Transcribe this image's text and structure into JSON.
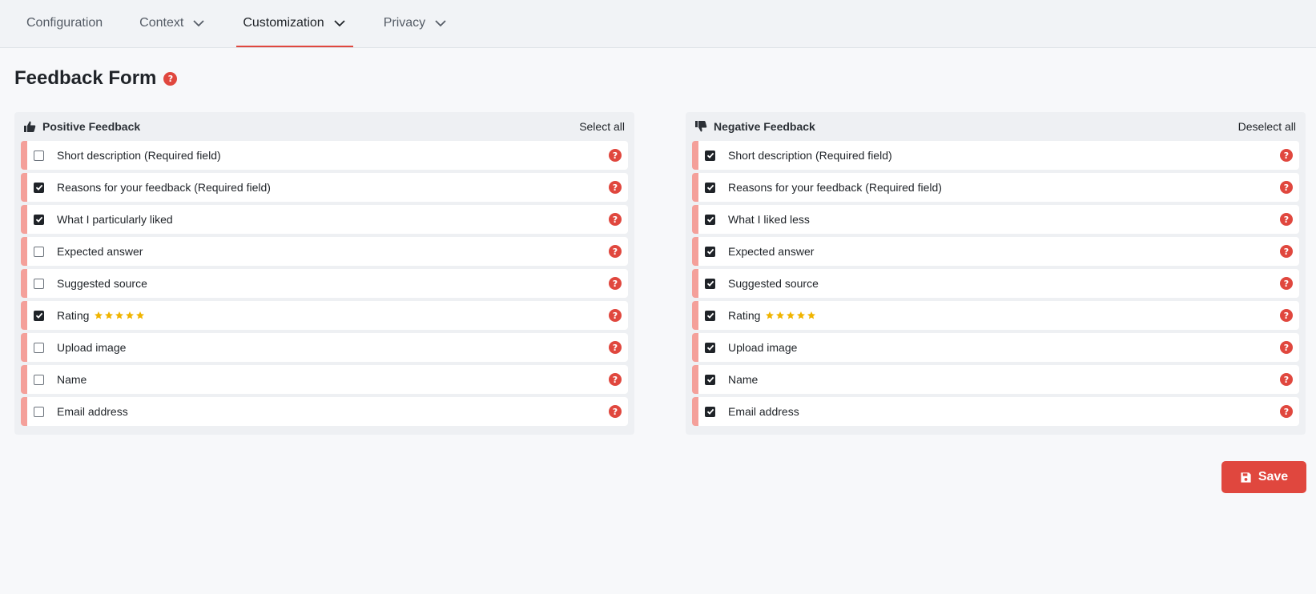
{
  "tabs": [
    {
      "label": "Configuration",
      "dropdown": false,
      "active": false
    },
    {
      "label": "Context",
      "dropdown": true,
      "active": false
    },
    {
      "label": "Customization",
      "dropdown": true,
      "active": true
    },
    {
      "label": "Privacy",
      "dropdown": true,
      "active": false
    }
  ],
  "page": {
    "title": "Feedback Form",
    "help_icon": "question-circle-icon"
  },
  "positive": {
    "title": "Positive Feedback",
    "icon": "thumbs-up-icon",
    "action_label": "Select all",
    "items": [
      {
        "label": "Short description (Required field)",
        "checked": false
      },
      {
        "label": "Reasons for your feedback (Required field)",
        "checked": true
      },
      {
        "label": "What I particularly liked",
        "checked": true
      },
      {
        "label": "Expected answer",
        "checked": false
      },
      {
        "label": "Suggested source",
        "checked": false
      },
      {
        "label": "Rating",
        "checked": true,
        "stars": 5
      },
      {
        "label": "Upload image",
        "checked": false
      },
      {
        "label": "Name",
        "checked": false
      },
      {
        "label": "Email address",
        "checked": false
      }
    ]
  },
  "negative": {
    "title": "Negative Feedback",
    "icon": "thumbs-down-icon",
    "action_label": "Deselect all",
    "items": [
      {
        "label": "Short description (Required field)",
        "checked": true
      },
      {
        "label": "Reasons for your feedback (Required field)",
        "checked": true
      },
      {
        "label": "What I liked less",
        "checked": true
      },
      {
        "label": "Expected answer",
        "checked": true
      },
      {
        "label": "Suggested source",
        "checked": true
      },
      {
        "label": "Rating",
        "checked": true,
        "stars": 5
      },
      {
        "label": "Upload image",
        "checked": true
      },
      {
        "label": "Name",
        "checked": true
      },
      {
        "label": "Email address",
        "checked": true
      }
    ]
  },
  "save": {
    "label": "Save",
    "icon": "floppy-disk-icon"
  },
  "colors": {
    "accent": "#e0473e",
    "row_marker": "#f4a09a",
    "star": "#f0b400"
  }
}
